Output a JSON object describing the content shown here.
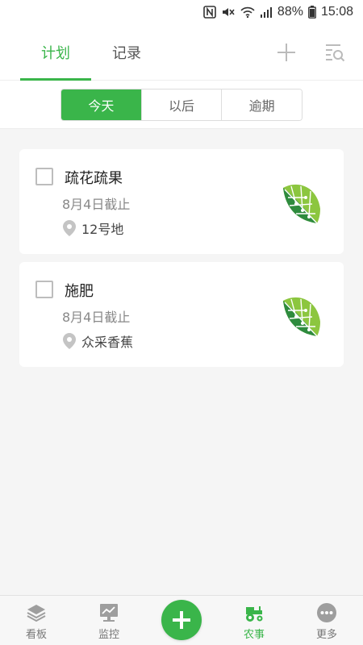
{
  "status_bar": {
    "battery": "88%",
    "time": "15:08",
    "icons": [
      "nfc-icon",
      "mute-icon",
      "wifi-icon",
      "signal-icon",
      "battery-icon"
    ]
  },
  "header": {
    "tabs": [
      {
        "label": "计划",
        "active": true
      },
      {
        "label": "记录",
        "active": false
      }
    ],
    "actions": [
      "plus-icon",
      "search-filter-icon"
    ]
  },
  "filter": {
    "segments": [
      {
        "label": "今天",
        "active": true
      },
      {
        "label": "以后",
        "active": false
      },
      {
        "label": "逾期",
        "active": false
      }
    ]
  },
  "tasks": [
    {
      "title": "疏花疏果",
      "due": "8月4日截止",
      "location": "12号地",
      "icon": "leaf-icon"
    },
    {
      "title": "施肥",
      "due": "8月4日截止",
      "location": "众采香蕉",
      "icon": "leaf-icon"
    }
  ],
  "bottom_nav": {
    "items": [
      {
        "label": "看板",
        "icon": "layers-icon",
        "active": false
      },
      {
        "label": "监控",
        "icon": "monitor-chart-icon",
        "active": false
      },
      {
        "label": "农事",
        "icon": "tractor-icon",
        "active": true
      },
      {
        "label": "更多",
        "icon": "more-dots-icon",
        "active": false
      }
    ],
    "center_button": "plus-icon"
  },
  "colors": {
    "accent": "#3ab54a",
    "leaf_light": "#8cc63f",
    "leaf_dark": "#2e8b3e"
  }
}
